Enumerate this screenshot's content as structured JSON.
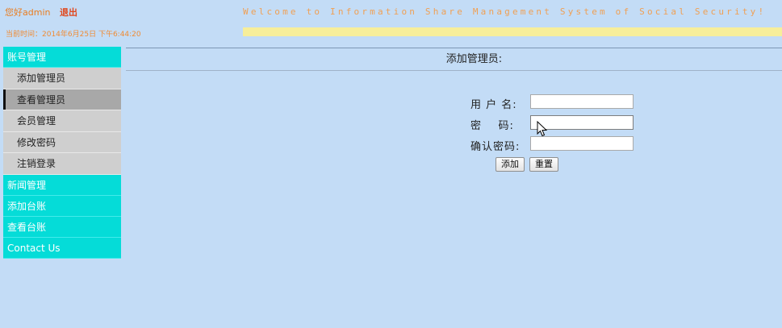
{
  "header": {
    "greeting": "您好admin",
    "logout": "退出",
    "welcome": "Welcome to Information Share Management System of Social Security!",
    "clock": "当前时间：2014年6月25日 下午6:44:20"
  },
  "sidebar": {
    "groups": [
      {
        "label": "账号管理"
      },
      {
        "label": "新闻管理"
      },
      {
        "label": "添加台账"
      },
      {
        "label": "查看台账"
      },
      {
        "label": "Contact Us"
      }
    ],
    "account_items": [
      {
        "label": "添加管理员"
      },
      {
        "label": "查看管理员",
        "active": true
      },
      {
        "label": "会员管理"
      },
      {
        "label": "修改密码"
      },
      {
        "label": "注销登录"
      }
    ]
  },
  "main": {
    "title": "添加管理员:",
    "form": {
      "username_label": "用 户 名:",
      "password_label": "密    码:",
      "confirm_label": "确认密码:",
      "username_value": "",
      "password_value": "",
      "confirm_value": "",
      "add_button": "添加",
      "reset_button": "重置"
    }
  },
  "colors": {
    "background": "#c3dcf6",
    "sidebar_group": "#05dcd8",
    "sidebar_item": "#cfcfcf",
    "accent_orange": "#ea7d1f",
    "marquee": "#f7ee9a"
  },
  "icons": {
    "cursor": "mouse-pointer-icon"
  }
}
